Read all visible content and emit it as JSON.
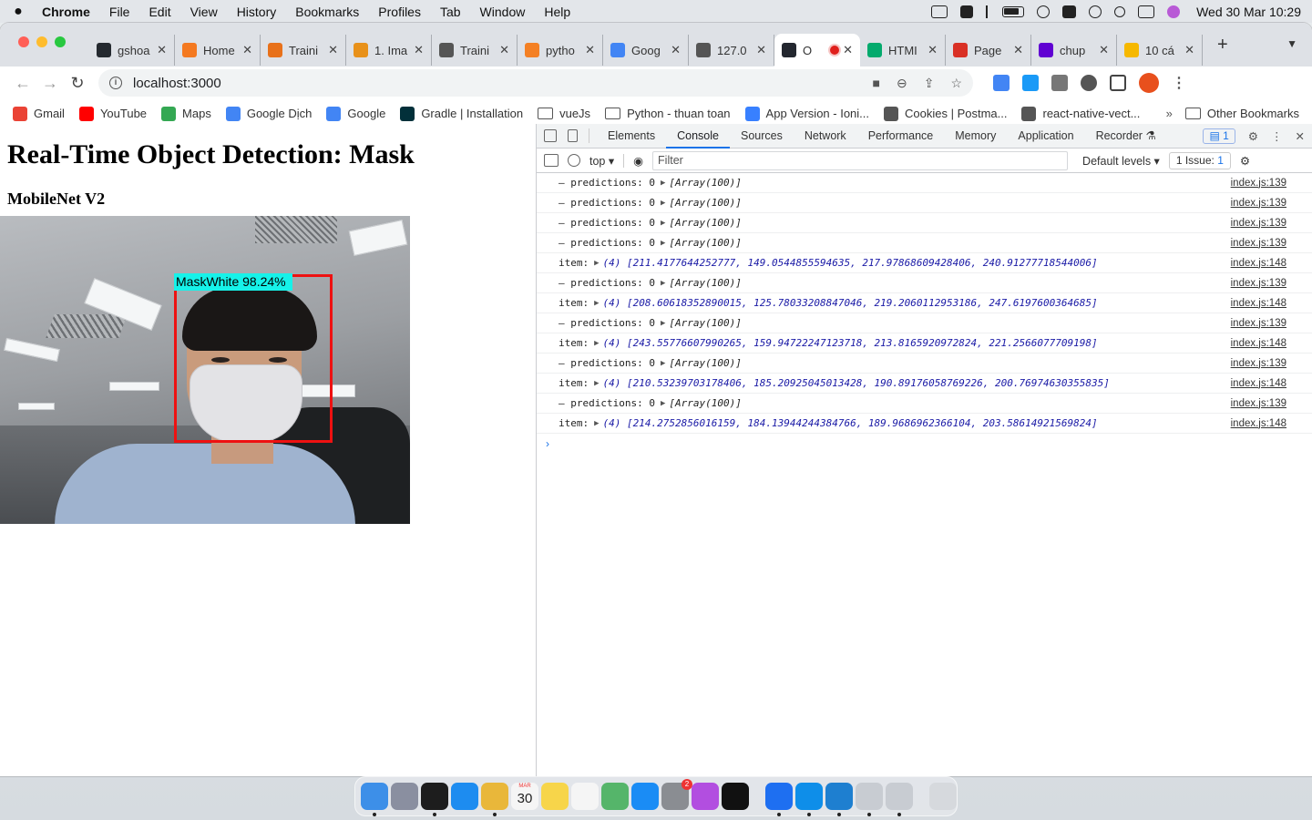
{
  "menubar": {
    "app": "Chrome",
    "menus": [
      "File",
      "Edit",
      "View",
      "History",
      "Bookmarks",
      "Profiles",
      "Tab",
      "Window",
      "Help"
    ],
    "clock": "Wed 30 Mar  10:29"
  },
  "tabs": [
    {
      "label": "gshoa",
      "color": "#24292f"
    },
    {
      "label": "Home",
      "color": "#f47920"
    },
    {
      "label": "Traini",
      "color": "#e8711a"
    },
    {
      "label": "1. Ima",
      "color": "#e8911a"
    },
    {
      "label": "Traini",
      "color": "#555555"
    },
    {
      "label": "pytho",
      "color": "#f48024"
    },
    {
      "label": "Goog",
      "color": "#4285f4"
    },
    {
      "label": "127.0",
      "color": "#555555"
    },
    {
      "label": "O",
      "color": "#23272f",
      "active": true
    },
    {
      "label": "HTMI",
      "color": "#04aa6d"
    },
    {
      "label": "Page",
      "color": "#d93025"
    },
    {
      "label": "chup",
      "color": "#6001d2"
    },
    {
      "label": "10 cá",
      "color": "#f6b800"
    }
  ],
  "toolbar": {
    "url": "localhost:3000"
  },
  "bookmarks": [
    {
      "label": "Gmail",
      "color": "#ea4335"
    },
    {
      "label": "YouTube",
      "color": "#ff0000"
    },
    {
      "label": "Maps",
      "color": "#34a853"
    },
    {
      "label": "Google Dịch",
      "color": "#4285f4"
    },
    {
      "label": "Google",
      "color": "#4285f4"
    },
    {
      "label": "Gradle | Installation",
      "color": "#02303a"
    },
    {
      "label": "vueJs",
      "folder": true
    },
    {
      "label": "Python - thuan toan",
      "folder": true
    },
    {
      "label": "App Version - Ioni...",
      "color": "#3880ff"
    },
    {
      "label": "Cookies | Postma...",
      "color": "#555555"
    },
    {
      "label": "react-native-vect...",
      "color": "#555555"
    }
  ],
  "bookmarks_more": "»",
  "other_bookmarks": "Other Bookmarks",
  "page": {
    "title": "Real-Time Object Detection: Mask",
    "subtitle": "MobileNet V2",
    "detection_label": "MaskWhite 98.24%"
  },
  "devtools": {
    "tabs": [
      "Elements",
      "Console",
      "Sources",
      "Network",
      "Performance",
      "Memory",
      "Application",
      "Recorder ⚗"
    ],
    "active_tab": "Console",
    "message_count": "1",
    "context": "top ▾",
    "filter_placeholder": "Filter",
    "levels": "Default levels ▾",
    "issues_label": "1 Issue:",
    "issues_count": "1"
  },
  "console": [
    {
      "type": "pred",
      "text": "– predictions: 0",
      "value": "[Array(100)]",
      "src": "index.js:139"
    },
    {
      "type": "pred",
      "text": "– predictions: 0",
      "value": "[Array(100)]",
      "src": "index.js:139"
    },
    {
      "type": "pred",
      "text": "– predictions: 0",
      "value": "[Array(100)]",
      "src": "index.js:139"
    },
    {
      "type": "pred",
      "text": "– predictions: 0",
      "value": "[Array(100)]",
      "src": "index.js:139"
    },
    {
      "type": "item",
      "text": "item:",
      "value": "(4) [211.4177644252777, 149.0544855594635, 217.97868609428406, 240.91277718544006]",
      "src": "index.js:148"
    },
    {
      "type": "pred",
      "text": "– predictions: 0",
      "value": "[Array(100)]",
      "src": "index.js:139"
    },
    {
      "type": "item",
      "text": "item:",
      "value": "(4) [208.60618352890015, 125.78033208847046, 219.2060112953186, 247.6197600364685]",
      "src": "index.js:148"
    },
    {
      "type": "pred",
      "text": "– predictions: 0",
      "value": "[Array(100)]",
      "src": "index.js:139"
    },
    {
      "type": "item",
      "text": "item:",
      "value": "(4) [243.55776607990265, 159.94722247123718, 213.8165920972824, 221.2566077709198]",
      "src": "index.js:148"
    },
    {
      "type": "pred",
      "text": "– predictions: 0",
      "value": "[Array(100)]",
      "src": "index.js:139"
    },
    {
      "type": "item",
      "text": "item:",
      "value": "(4) [210.53239703178406, 185.20925045013428, 190.89176058769226, 200.76974630355835]",
      "src": "index.js:148"
    },
    {
      "type": "pred",
      "text": "– predictions: 0",
      "value": "[Array(100)]",
      "src": "index.js:139"
    },
    {
      "type": "item",
      "text": "item:",
      "value": "(4) [214.2752856016159, 184.13944244384766, 189.9686962366104, 203.58614921569824]",
      "src": "index.js:148"
    }
  ],
  "console_prompt": "›",
  "dock": {
    "apps": [
      {
        "name": "Finder",
        "color": "#3d8fe8",
        "running": true
      },
      {
        "name": "Launchpad",
        "color": "#8a8fa0"
      },
      {
        "name": "Terminal",
        "color": "#1d1d1d",
        "running": true
      },
      {
        "name": "Safari",
        "color": "#1d8cf0"
      },
      {
        "name": "Chrome",
        "color": "#e9b73a",
        "running": true
      },
      {
        "name": "Calendar",
        "color": "#f5f5f5",
        "running": false
      },
      {
        "name": "Notes",
        "color": "#f7d54a"
      },
      {
        "name": "Reminders",
        "color": "#f5f5f5"
      },
      {
        "name": "Maps",
        "color": "#55b56a"
      },
      {
        "name": "App Store",
        "color": "#1a8cf5"
      },
      {
        "name": "System Preferences",
        "color": "#8a8d92",
        "badge": "2"
      },
      {
        "name": "Podcasts",
        "color": "#b24ee0"
      },
      {
        "name": "Apple TV",
        "color": "#111111"
      },
      {
        "name": "Zalo",
        "color": "#1e6ff1",
        "running": true,
        "sep_before": true
      },
      {
        "name": "TeamViewer",
        "color": "#0e8ee9",
        "running": true
      },
      {
        "name": "VS Code",
        "color": "#1e7fd0",
        "running": true
      },
      {
        "name": "Rocket",
        "color": "#c8ccd2",
        "running": true
      },
      {
        "name": "Rocket 2",
        "color": "#c8ccd2",
        "running": true
      },
      {
        "name": "Trash",
        "color": "#d6d9dd",
        "sep_before": true
      }
    ],
    "calendar_day": "30",
    "calendar_month": "MAR"
  }
}
